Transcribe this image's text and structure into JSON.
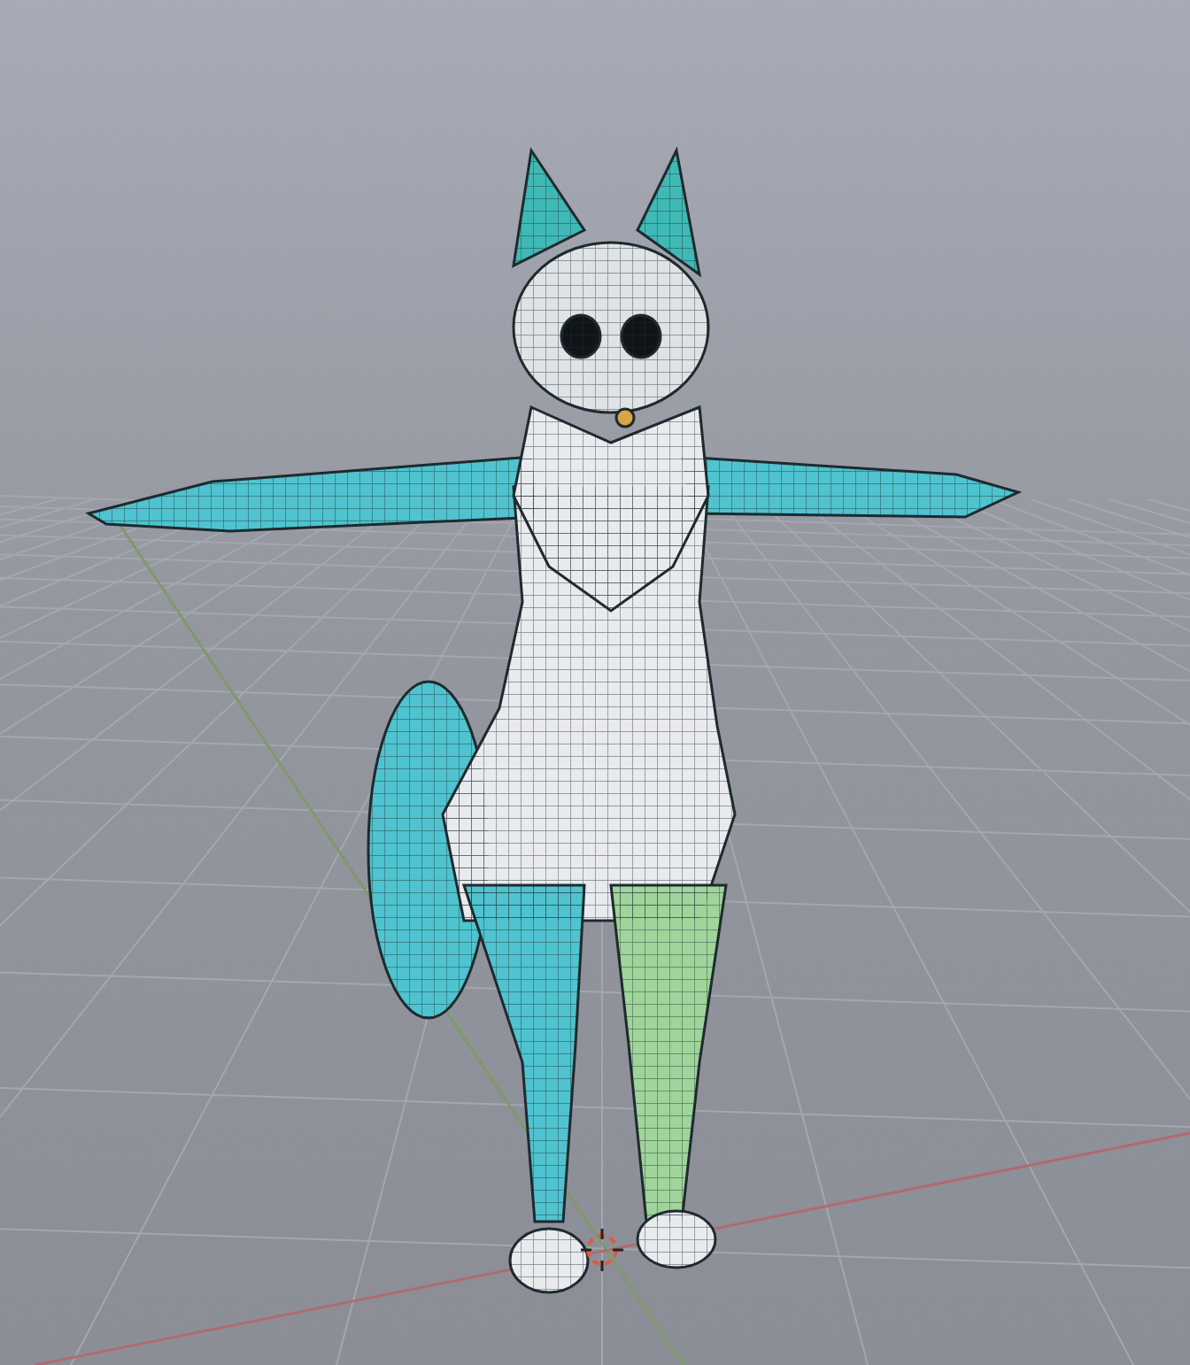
{
  "viewport": {
    "show_grid": true,
    "show_axes": true,
    "show_3d_cursor": true
  }
}
